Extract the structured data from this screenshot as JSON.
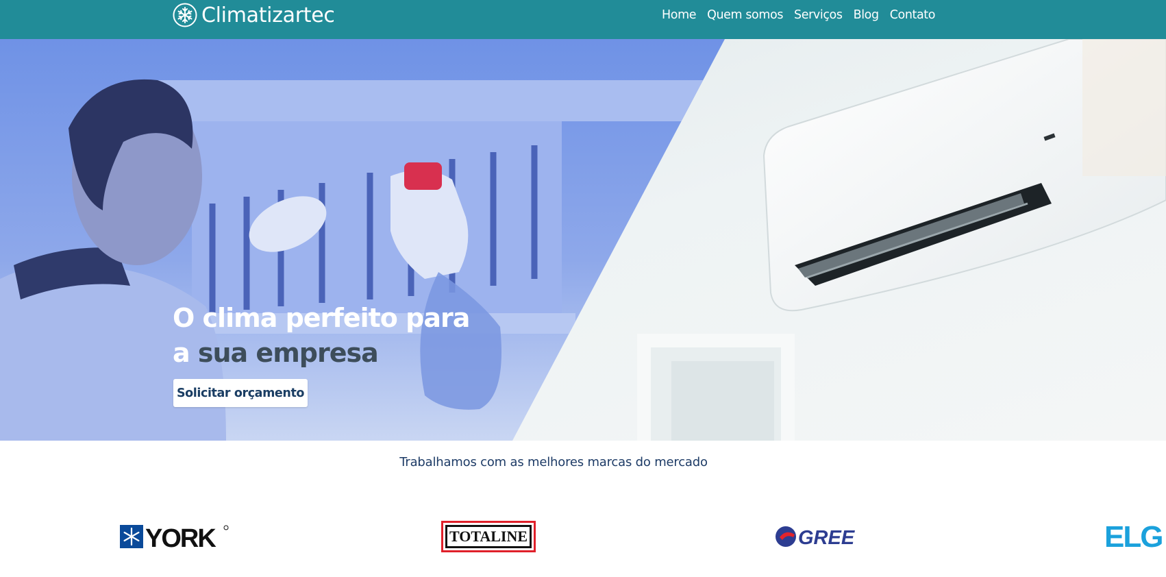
{
  "header": {
    "brand_name": "Climatizartec",
    "brand_icon": "snowflake-icon",
    "nav": [
      {
        "label": "Home"
      },
      {
        "label": "Quem somos"
      },
      {
        "label": "Serviços"
      },
      {
        "label": "Blog"
      },
      {
        "label": "Contato"
      }
    ]
  },
  "hero": {
    "title_line1": "O clima perfeito para",
    "title_line2_prefix": "a",
    "title_line2_emphasis": "sua empresa",
    "cta_label": "Solicitar orçamento"
  },
  "brands": {
    "caption": "Trabalhamos com as melhores marcas do mercado",
    "logos": [
      {
        "text": "YORK",
        "icon": "snowflake-icon"
      },
      {
        "text": "TOTALINE"
      },
      {
        "text": "GREE"
      },
      {
        "text": "ELG"
      }
    ]
  },
  "colors": {
    "header_bg": "#218c98",
    "text_dark_blue": "#1d3b66",
    "york_blue": "#0a4a9a",
    "totaline_red": "#e0202a",
    "gree_blue": "#2d3d91",
    "gree_red": "#e2242b",
    "elgin_blue": "#1ba1dc"
  }
}
